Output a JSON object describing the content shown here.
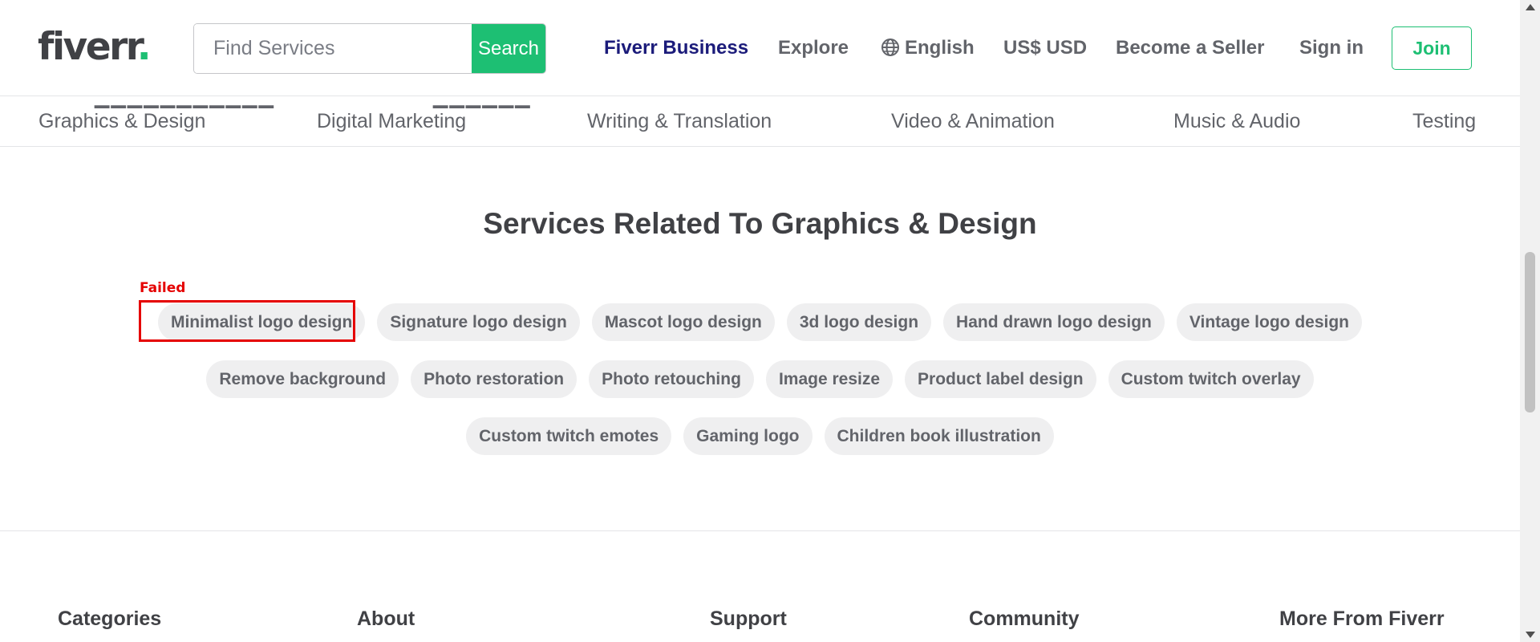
{
  "header": {
    "logo_text": "fiverr",
    "logo_dot": ".",
    "search": {
      "placeholder": "Find Services",
      "button_label": "Search"
    },
    "nav": {
      "business": "Fiverr Business",
      "explore": "Explore",
      "language": "English",
      "currency": "US$ USD",
      "become_seller": "Become a Seller",
      "sign_in": "Sign in",
      "join": "Join"
    },
    "colors": {
      "brand_green": "#1dbf73",
      "business_navy": "#1b1b7a"
    }
  },
  "categories": [
    "Graphics & Design",
    "Digital Marketing",
    "Writing & Translation",
    "Video & Animation",
    "Music & Audio",
    "Testing"
  ],
  "related": {
    "title": "Services Related To Graphics & Design",
    "rows": [
      [
        "Minimalist logo design",
        "Signature logo design",
        "Mascot logo design",
        "3d logo design",
        "Hand drawn logo design",
        "Vintage logo design"
      ],
      [
        "Remove background",
        "Photo restoration",
        "Photo retouching",
        "Image resize",
        "Product label design",
        "Custom twitch overlay"
      ],
      [
        "Custom twitch emotes",
        "Gaming logo",
        "Children book illustration"
      ]
    ],
    "failed_label": "Failed",
    "failed_color": "#e50000"
  },
  "footer": {
    "headings": [
      "Categories",
      "About",
      "Support",
      "Community",
      "More From Fiverr"
    ]
  }
}
